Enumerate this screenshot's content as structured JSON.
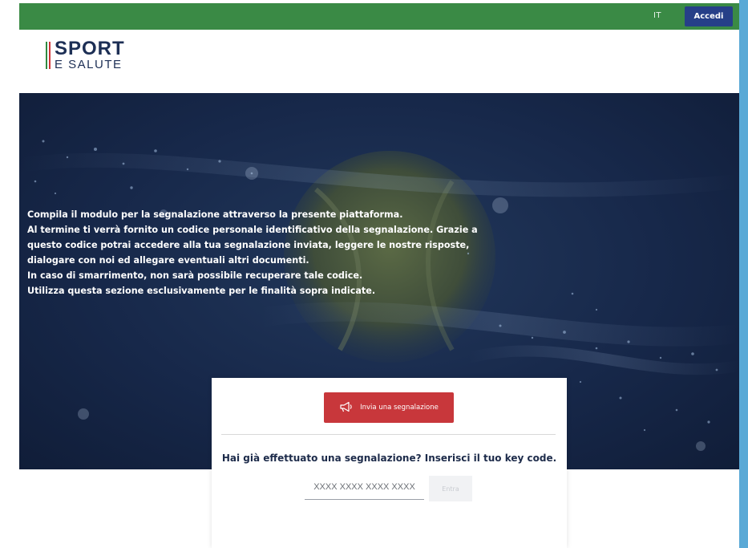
{
  "header": {
    "language": "IT",
    "login_label": "Accedi"
  },
  "logo": {
    "line1": "SPORT",
    "line2": "E SALUTE"
  },
  "hero": {
    "lines": [
      "Compila il modulo per la segnalazione attraverso la presente piattaforma.",
      "Al termine ti verrà fornito un codice personale identificativo della segnalazione. Grazie a",
      "questo codice potrai accedere alla tua segnalazione inviata, leggere le nostre risposte,",
      "dialogare con noi ed allegare eventuali altri documenti.",
      "In caso di smarrimento, non sarà possibile recuperare tale codice.",
      "Utilizza questa sezione esclusivamente per le finalità sopra indicate."
    ]
  },
  "card": {
    "report_button_label": "Invia una segnalazione",
    "report_button_icon": "megaphone-icon",
    "question": "Hai già effettuato una segnalazione? Inserisci il tuo key code.",
    "keycode_placeholder": "XXXX XXXX XXXX XXXX",
    "keycode_value": "",
    "enter_label": "Entra"
  },
  "colors": {
    "topbar": "#3a8a45",
    "login_button": "#263f88",
    "hero_background": "#17284a",
    "report_button": "#c8373b",
    "outer_background": "#5aa9d6"
  }
}
